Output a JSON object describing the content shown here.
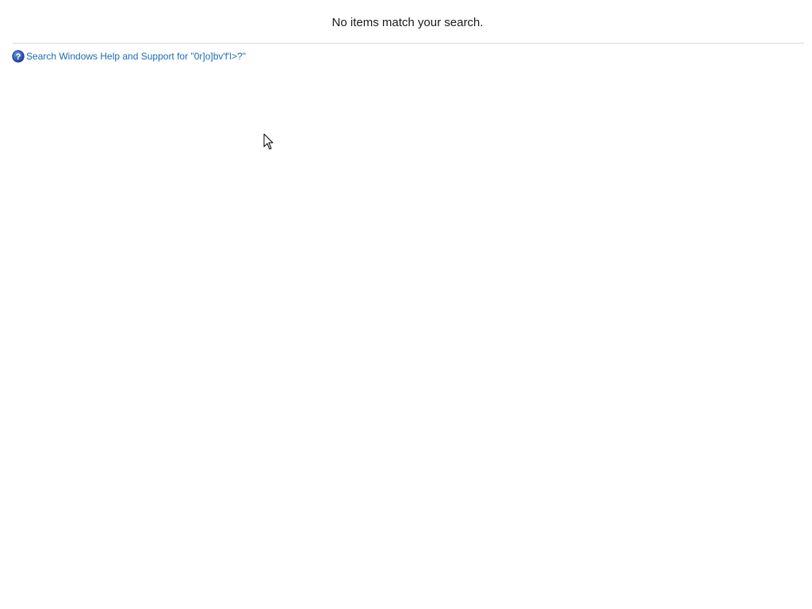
{
  "results": {
    "empty_message": "No items match your search."
  },
  "help_link": {
    "label": "Search Windows Help and Support for \"0r]o]bv'f'l>?\"",
    "icon": "help-icon",
    "color": "#1e6ab4"
  },
  "cursor": {
    "icon": "arrow-cursor-icon"
  }
}
